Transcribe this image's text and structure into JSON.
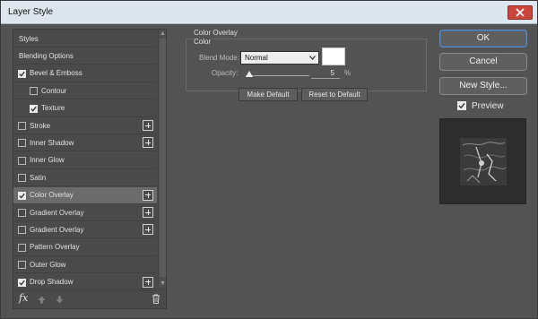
{
  "window": {
    "title": "Layer Style"
  },
  "sidebar": {
    "items": [
      {
        "label": "Styles",
        "checkbox": false,
        "checked": false,
        "plus": false,
        "selected": false
      },
      {
        "label": "Blending Options",
        "checkbox": false,
        "checked": false,
        "plus": false,
        "selected": false
      },
      {
        "label": "Bevel & Emboss",
        "checkbox": true,
        "checked": true,
        "plus": false,
        "selected": false
      },
      {
        "label": "Contour",
        "checkbox": true,
        "checked": false,
        "plus": false,
        "selected": false
      },
      {
        "label": "Texture",
        "checkbox": true,
        "checked": true,
        "plus": false,
        "selected": false
      },
      {
        "label": "Stroke",
        "checkbox": true,
        "checked": false,
        "plus": true,
        "selected": false
      },
      {
        "label": "Inner Shadow",
        "checkbox": true,
        "checked": false,
        "plus": true,
        "selected": false
      },
      {
        "label": "Inner Glow",
        "checkbox": true,
        "checked": false,
        "plus": false,
        "selected": false
      },
      {
        "label": "Satin",
        "checkbox": true,
        "checked": false,
        "plus": false,
        "selected": false
      },
      {
        "label": "Color Overlay",
        "checkbox": true,
        "checked": true,
        "plus": true,
        "selected": true
      },
      {
        "label": "Gradient Overlay",
        "checkbox": true,
        "checked": false,
        "plus": true,
        "selected": false
      },
      {
        "label": "Gradient Overlay",
        "checkbox": true,
        "checked": false,
        "plus": true,
        "selected": false
      },
      {
        "label": "Pattern Overlay",
        "checkbox": true,
        "checked": false,
        "plus": false,
        "selected": false
      },
      {
        "label": "Outer Glow",
        "checkbox": true,
        "checked": false,
        "plus": false,
        "selected": false
      },
      {
        "label": "Drop Shadow",
        "checkbox": true,
        "checked": true,
        "plus": true,
        "selected": false
      }
    ],
    "footer": {
      "fx_label": "fx"
    }
  },
  "color_overlay": {
    "section_title": "Color Overlay",
    "group_title": "Color",
    "blend_mode_label": "Blend Mode:",
    "blend_mode_value": "Normal",
    "swatch_color": "#ffffff",
    "opacity_label": "Opacity:",
    "opacity_value": "5",
    "opacity_unit": "%",
    "opacity_level": 0.05,
    "make_default_label": "Make Default",
    "reset_default_label": "Reset to Default"
  },
  "actions": {
    "ok_label": "OK",
    "cancel_label": "Cancel",
    "new_style_label": "New Style...",
    "preview_label": "Preview",
    "preview_checked": true
  },
  "colors": {
    "panel_bg": "#535353",
    "selected_item": "#6b6b6b",
    "ok_border": "#5b8ec9",
    "close_button": "#c9463d"
  }
}
